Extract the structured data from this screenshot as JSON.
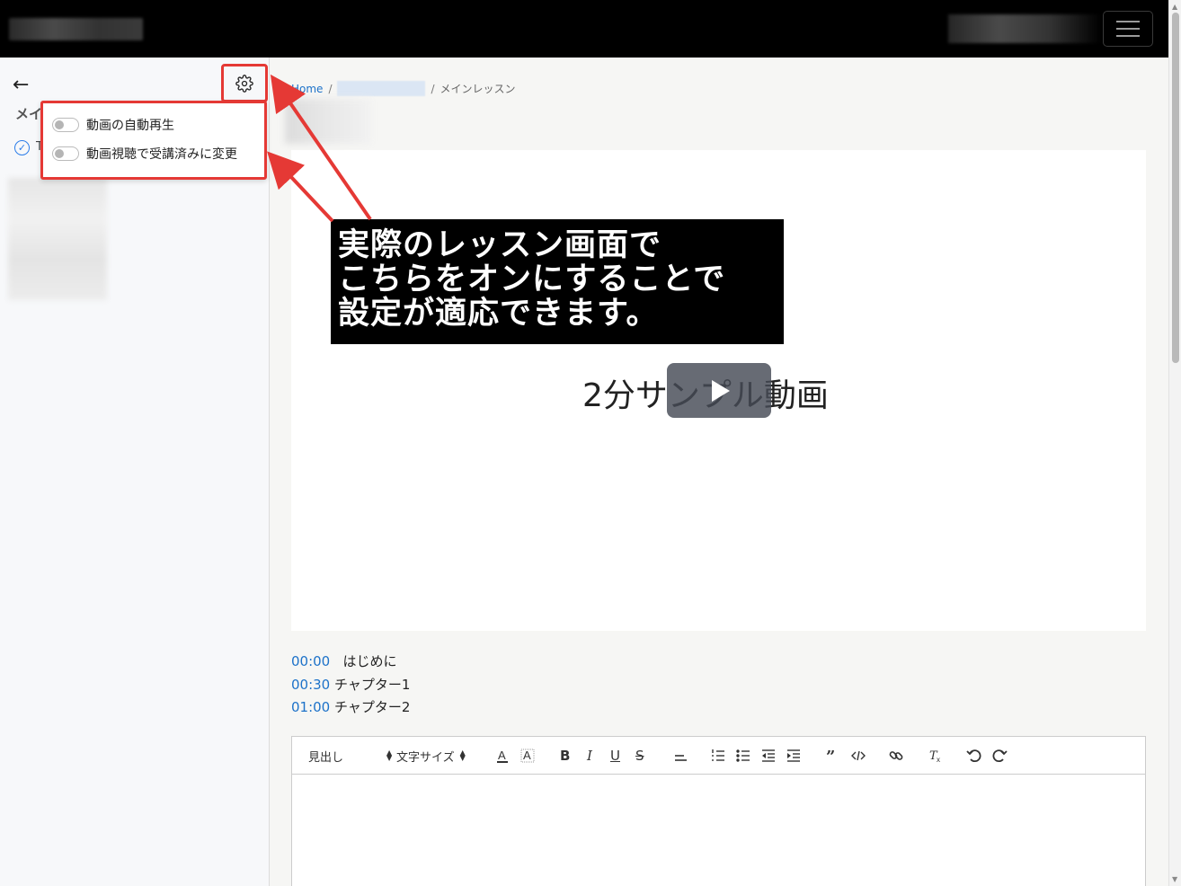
{
  "topbar": {
    "menu_icon": "hamburger-icon"
  },
  "sidebar": {
    "back_icon": "arrow-left-icon",
    "back_glyph": "←",
    "settings_icon": "gear-icon",
    "section_title": "メイ",
    "check_glyph": "✓",
    "item_label": "T"
  },
  "settings_menu": {
    "autoplay_label": "動画の自動再生",
    "mark_complete_label": "動画視聴で受講済みに変更"
  },
  "breadcrumb": {
    "home": "Home",
    "sep": "/",
    "current": "メインレッスン"
  },
  "video": {
    "title": "2分サンプル動画",
    "play_icon": "play-icon"
  },
  "callout": {
    "line1": "実際のレッスン画面で",
    "line2": "こちらをオンにすることで",
    "line3": "設定が適応できます。"
  },
  "chapters": [
    {
      "time": "00:00",
      "name": "はじめに"
    },
    {
      "time": "00:30",
      "name": "チャプター1"
    },
    {
      "time": "01:00",
      "name": "チャプター2"
    }
  ],
  "editor": {
    "heading_select": "見出し",
    "fontsize_select": "文字サイズ",
    "bold": "B",
    "italic": "I",
    "underline": "U",
    "strike": "S"
  },
  "colors": {
    "accent": "#e53935",
    "link": "#1d72c9",
    "topbar": "#000000"
  }
}
